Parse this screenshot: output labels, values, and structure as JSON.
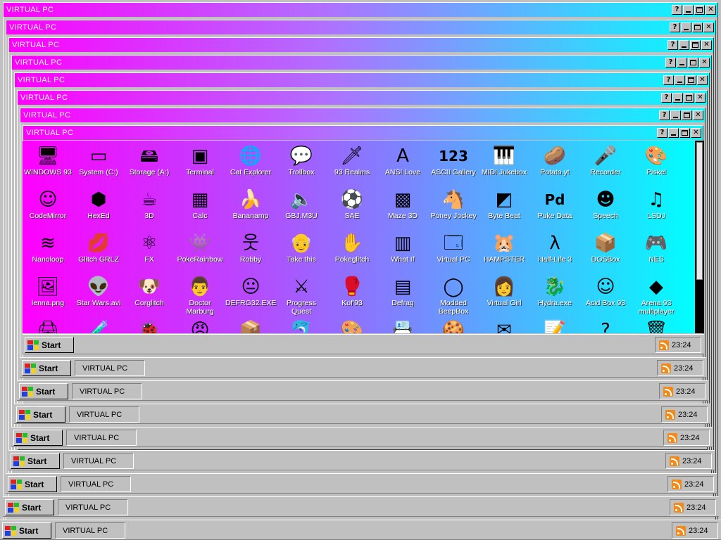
{
  "window": {
    "title": "VIRTUAL PC",
    "help_label": "?"
  },
  "taskbar": {
    "start_label": "Start",
    "task_label": "VIRTUAL PC",
    "clock": "23:24"
  },
  "desktop_icons": [
    {
      "label": "WINDOWS 93",
      "icon": "computer-icon",
      "glyph": "🖥"
    },
    {
      "label": "System (C:)",
      "icon": "hard-drive-icon",
      "glyph": "▭"
    },
    {
      "label": "Storage (A:)",
      "icon": "floppy-drive-icon",
      "glyph": "🖴"
    },
    {
      "label": "Terminal",
      "icon": "terminal-icon",
      "glyph": "▣"
    },
    {
      "label": "Cat Explorer",
      "icon": "cat-explorer-icon",
      "glyph": "🌐"
    },
    {
      "label": "Trollbox",
      "icon": "trollbox-icon",
      "glyph": "💬"
    },
    {
      "label": "93 Realms",
      "icon": "realms-icon",
      "glyph": "🗡"
    },
    {
      "label": "ANSI Love",
      "icon": "ansi-love-icon",
      "glyph": "A"
    },
    {
      "label": "ASCII Gallery",
      "icon": "ascii-gallery-icon",
      "glyph": "123"
    },
    {
      "label": "MIDI Jukebox",
      "icon": "piano-icon",
      "glyph": "🎹"
    },
    {
      "label": "Potato.yt",
      "icon": "potato-icon",
      "glyph": "🥔"
    },
    {
      "label": "Recorder",
      "icon": "microphone-icon",
      "glyph": "🎤"
    },
    {
      "label": "Piskel",
      "icon": "palette-icon",
      "glyph": "🎨"
    },
    {
      "label": "CodeMirror",
      "icon": "codemirror-icon",
      "glyph": "☺"
    },
    {
      "label": "HexEd",
      "icon": "cube-icon",
      "glyph": "⬢"
    },
    {
      "label": "3D",
      "icon": "teapot-icon",
      "glyph": "☕"
    },
    {
      "label": "Calc",
      "icon": "calculator-icon",
      "glyph": "▦"
    },
    {
      "label": "Bananamp",
      "icon": "banana-icon",
      "glyph": "🍌"
    },
    {
      "label": "GBJ.M3U",
      "icon": "speaker-icon",
      "glyph": "🔈"
    },
    {
      "label": "SAE",
      "icon": "ball-icon",
      "glyph": "⚽"
    },
    {
      "label": "Maze 3D",
      "icon": "maze-icon",
      "glyph": "▩"
    },
    {
      "label": "Poney Jockey",
      "icon": "pony-icon",
      "glyph": "🐴"
    },
    {
      "label": "Byte Beat",
      "icon": "byte-beat-icon",
      "glyph": "◩"
    },
    {
      "label": "Puke Data",
      "icon": "puke-data-icon",
      "glyph": "Pd"
    },
    {
      "label": "Speech",
      "icon": "speech-icon",
      "glyph": "☻"
    },
    {
      "label": "LSDJ",
      "icon": "lsdj-icon",
      "glyph": "♫"
    },
    {
      "label": "Nanoloop",
      "icon": "nanoloop-icon",
      "glyph": "≋"
    },
    {
      "label": "Glitch GRLZ",
      "icon": "lips-icon",
      "glyph": "💋"
    },
    {
      "label": "FX",
      "icon": "atom-icon",
      "glyph": "⚛"
    },
    {
      "label": "PokeRainbow",
      "icon": "pokerainbow-icon",
      "glyph": "👾"
    },
    {
      "label": "Robby",
      "icon": "stick-figure-icon",
      "glyph": "웃"
    },
    {
      "label": "Take this",
      "icon": "take-this-icon",
      "glyph": "👴"
    },
    {
      "label": "Pokeglitch",
      "icon": "pokeglitch-icon",
      "glyph": "✋"
    },
    {
      "label": "What If",
      "icon": "what-if-icon",
      "glyph": "▥"
    },
    {
      "label": "Virtual PC",
      "icon": "virtual-pc-icon",
      "glyph": "🗔"
    },
    {
      "label": "HAMPSTER",
      "icon": "hamster-icon",
      "glyph": "🐹"
    },
    {
      "label": "Half-Life 3",
      "icon": "half-life-icon",
      "glyph": "λ"
    },
    {
      "label": "DOSBox",
      "icon": "dosbox-icon",
      "glyph": "📦"
    },
    {
      "label": "NES",
      "icon": "nes-icon",
      "glyph": "🎮"
    },
    {
      "label": "lenna.png",
      "icon": "image-file-icon",
      "glyph": "🖼"
    },
    {
      "label": "Star Wars.avi",
      "icon": "yoda-icon",
      "glyph": "👽"
    },
    {
      "label": "Corglitch",
      "icon": "corgi-icon",
      "glyph": "🐶"
    },
    {
      "label": "Doctor Marburg",
      "icon": "doctor-icon",
      "glyph": "👨"
    },
    {
      "label": "DEFRG32.EXE",
      "icon": "defrag-face-icon",
      "glyph": "😐"
    },
    {
      "label": "Progress Quest",
      "icon": "swords-icon",
      "glyph": "⚔"
    },
    {
      "label": "Kof'93",
      "icon": "fighter-icon",
      "glyph": "🥊"
    },
    {
      "label": "Defrag",
      "icon": "defrag-icon",
      "glyph": "▤"
    },
    {
      "label": "Modded BeepBox",
      "icon": "beepbox-icon",
      "glyph": "◯"
    },
    {
      "label": "Virtual Girl",
      "icon": "virtual-girl-icon",
      "glyph": "👩"
    },
    {
      "label": "Hydra.exe",
      "icon": "hydra-icon",
      "glyph": "🐉"
    },
    {
      "label": "Acid Box 93",
      "icon": "smiley-icon",
      "glyph": "☺"
    },
    {
      "label": "Arena 93 multiplayer",
      "icon": "arena-cube-icon",
      "glyph": "◆"
    },
    {
      "label": "",
      "icon": "printer-icon",
      "glyph": "🖨"
    },
    {
      "label": "",
      "icon": "bottle-icon",
      "glyph": "🧪"
    },
    {
      "label": "",
      "icon": "bug-icon",
      "glyph": "🐞"
    },
    {
      "label": "",
      "icon": "face-icon",
      "glyph": "😠"
    },
    {
      "label": "",
      "icon": "box-icon",
      "glyph": "📦"
    },
    {
      "label": "",
      "icon": "dolphin-icon",
      "glyph": "🐬"
    },
    {
      "label": "",
      "icon": "paint-file-icon",
      "glyph": "🎨"
    },
    {
      "label": "",
      "icon": "contact-card-icon",
      "glyph": "📇"
    },
    {
      "label": "",
      "icon": "cookie-icon",
      "glyph": "🍪"
    },
    {
      "label": "",
      "icon": "envelope-icon",
      "glyph": "✉"
    },
    {
      "label": "",
      "icon": "notepad-icon",
      "glyph": "📝"
    },
    {
      "label": "",
      "icon": "question-icon",
      "glyph": "?"
    },
    {
      "label": "",
      "icon": "recycle-bin-icon",
      "glyph": "🗑"
    }
  ]
}
